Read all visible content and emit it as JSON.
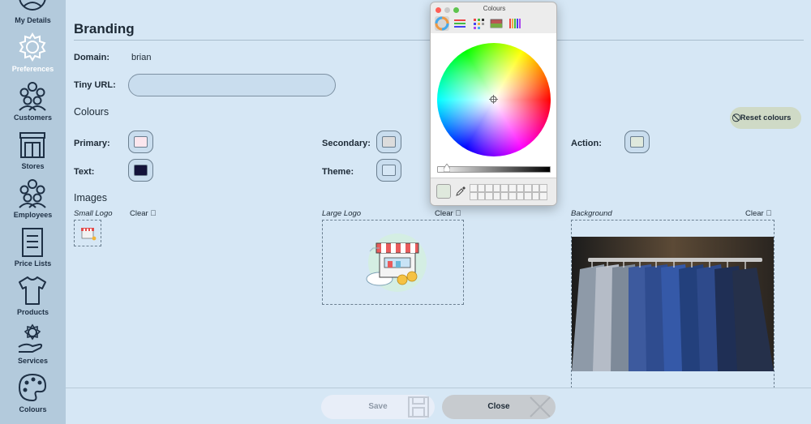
{
  "sidebar": {
    "items": [
      {
        "label": "My Details",
        "icon": "my-details-icon"
      },
      {
        "label": "Preferences",
        "icon": "gear-icon",
        "active": true
      },
      {
        "label": "Customers",
        "icon": "customers-icon"
      },
      {
        "label": "Stores",
        "icon": "store-icon"
      },
      {
        "label": "Employees",
        "icon": "employees-icon"
      },
      {
        "label": "Price Lists",
        "icon": "price-list-icon"
      },
      {
        "label": "Products",
        "icon": "tshirt-icon"
      },
      {
        "label": "Services",
        "icon": "services-icon"
      },
      {
        "label": "Colours",
        "icon": "palette-icon"
      }
    ]
  },
  "branding": {
    "title": "Branding",
    "domain_label": "Domain:",
    "domain_value": "brian",
    "tinyurl_label": "Tiny URL:",
    "tinyurl_value": "",
    "colours_title": "Colours",
    "reset_label": "Reset colours",
    "colours": {
      "primary": {
        "label": "Primary:",
        "color": "#fbe6ee"
      },
      "secondary": {
        "label": "Secondary:",
        "color": "#dcdcdc"
      },
      "action": {
        "label": "Action:",
        "color": "#dfe9dd"
      },
      "text": {
        "label": "Text:",
        "color": "#13123a"
      },
      "theme": {
        "label": "Theme:",
        "color": "#d6e7f5"
      }
    },
    "images_title": "Images",
    "small_logo_label": "Small Logo",
    "large_logo_label": "Large Logo",
    "background_label": "Background",
    "clear_label": "Clear"
  },
  "footer": {
    "save_label": "Save",
    "close_label": "Close"
  },
  "picker": {
    "title": "Colours",
    "current_color": "#dfe9dd"
  }
}
